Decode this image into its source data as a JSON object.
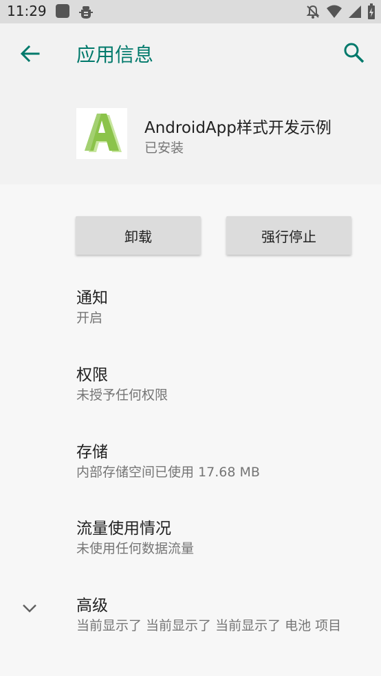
{
  "status_bar": {
    "time": "11:29",
    "icons": [
      "square-icon",
      "bug-icon",
      "notifications-off-icon",
      "wifi-icon",
      "signal-icon",
      "battery-icon"
    ]
  },
  "app_bar": {
    "title": "应用信息",
    "back_icon": "arrow-back-icon",
    "search_icon": "search-icon",
    "accent_color": "#00796b"
  },
  "app": {
    "name": "AndroidApp样式开发示例",
    "status": "已安装",
    "icon": "letter-a-logo"
  },
  "buttons": {
    "uninstall": "卸载",
    "force_stop": "强行停止"
  },
  "items": [
    {
      "title": "通知",
      "subtitle": "开启"
    },
    {
      "title": "权限",
      "subtitle": "未授予任何权限"
    },
    {
      "title": "存储",
      "subtitle": "内部存储空间已使用 17.68 MB"
    },
    {
      "title": "流量使用情况",
      "subtitle": "未使用任何数据流量"
    },
    {
      "title": "高级",
      "subtitle": "当前显示了 当前显示了 当前显示了 电池 项目",
      "icon": "chevron-down-icon"
    }
  ]
}
